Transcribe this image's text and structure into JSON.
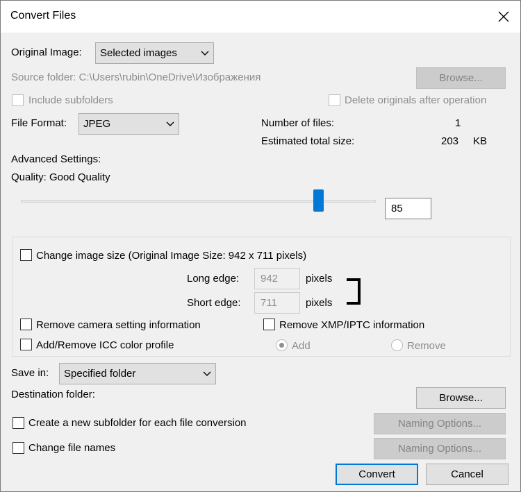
{
  "window": {
    "title": "Convert Files"
  },
  "original_image": {
    "label": "Original Image:",
    "selected": "Selected images"
  },
  "source_folder": {
    "text": "Source folder: C:\\Users\\rubin\\OneDrive\\Изображения",
    "browse_label": "Browse..."
  },
  "include_subfolders": {
    "label": "Include subfolders",
    "checked": false,
    "disabled": true
  },
  "delete_originals": {
    "label": "Delete originals after operation",
    "checked": false,
    "disabled": true
  },
  "file_format": {
    "label": "File Format:",
    "selected": "JPEG"
  },
  "stats": {
    "num_files_label": "Number of files:",
    "num_files_value": "1",
    "total_size_label": "Estimated total size:",
    "total_size_value": "203",
    "total_size_unit": "KB"
  },
  "advanced": {
    "label": "Advanced Settings:",
    "quality_label": "Quality: Good Quality",
    "quality_value": "85",
    "quality_fraction": 0.85
  },
  "resize": {
    "checkbox_label": "Change image size (Original Image Size: 942 x 711 pixels)",
    "checked": false,
    "long_edge_label": "Long edge:",
    "long_edge_value": "942",
    "short_edge_label": "Short edge:",
    "short_edge_value": "711",
    "unit": "pixels"
  },
  "remove_camera": {
    "label": "Remove camera setting information",
    "checked": false
  },
  "remove_xmp": {
    "label": "Remove XMP/IPTC information",
    "checked": false
  },
  "icc": {
    "label": "Add/Remove ICC color profile",
    "checked": false,
    "add_label": "Add",
    "remove_label": "Remove",
    "selected": "Add"
  },
  "save_in": {
    "label": "Save in:",
    "selected": "Specified folder"
  },
  "destination": {
    "label": "Destination folder:",
    "browse_label": "Browse..."
  },
  "subfolder": {
    "label": "Create a new subfolder for each file conversion",
    "checked": false,
    "naming_label": "Naming Options..."
  },
  "change_names": {
    "label": "Change file names",
    "checked": false,
    "naming_label": "Naming Options..."
  },
  "actions": {
    "convert": "Convert",
    "cancel": "Cancel"
  },
  "icons": [
    "close-icon",
    "chevron-down-icon"
  ],
  "colors": {
    "accent": "#0078d7",
    "background": "#f0f0f0"
  }
}
